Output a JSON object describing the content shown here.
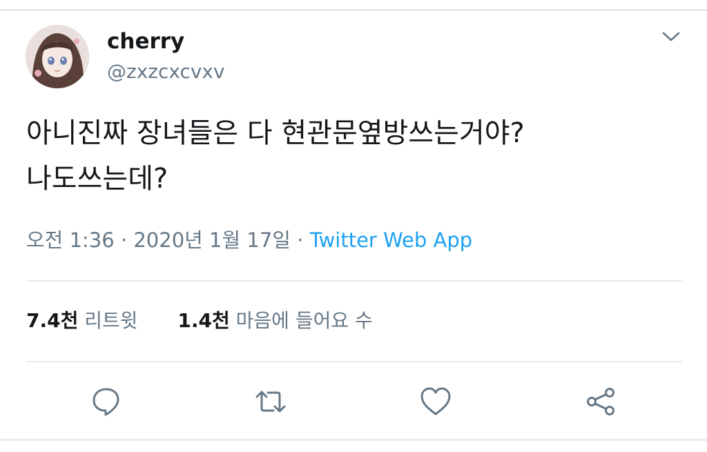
{
  "user": {
    "display_name": "cherry",
    "handle": "@zxzcxcvxv"
  },
  "tweet": {
    "lines": [
      "아니진짜 장녀들은 다 현관문옆방쓰는거야?",
      "나도쓰는데?"
    ],
    "time": "오전 1:36",
    "separator": "·",
    "date": "2020년 1월 17일",
    "source": "Twitter Web App"
  },
  "stats": {
    "retweets_count": "7.4천",
    "retweets_label": "리트윗",
    "likes_count": "1.4천",
    "likes_label": "마음에 들어요 수"
  },
  "actions": {
    "icons": [
      "reply-icon",
      "retweet-icon",
      "like-icon",
      "share-icon"
    ]
  },
  "colors": {
    "text": "#14171a",
    "secondary": "#657786",
    "accent": "#1da1f2",
    "divider": "#e6ecf0"
  }
}
